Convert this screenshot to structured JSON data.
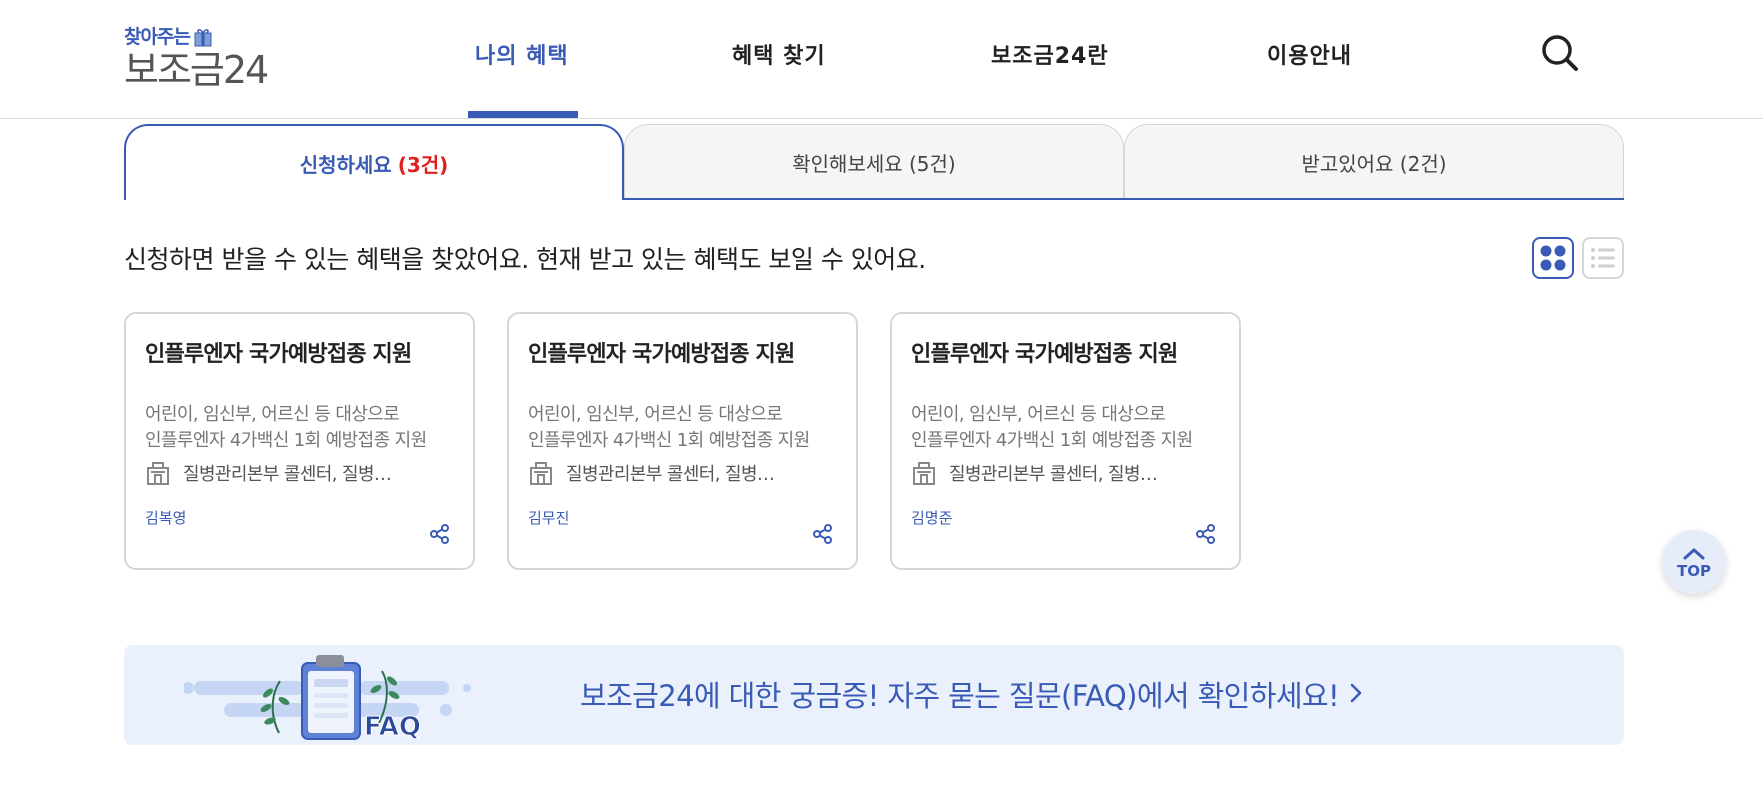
{
  "header": {
    "logo_top": "찾아주는",
    "logo_main": "보조금24",
    "nav": [
      {
        "label": "나의 혜택",
        "active": true
      },
      {
        "label": "혜택 찾기",
        "active": false
      },
      {
        "label": "보조금24란",
        "active": false
      },
      {
        "label": "이용안내",
        "active": false
      }
    ],
    "search_icon": "search-icon"
  },
  "tabs": [
    {
      "label": "신청하세요",
      "count": "(3건)",
      "active": true
    },
    {
      "label": "확인해보세요 (5건)",
      "active": false
    },
    {
      "label": "받고있어요 (2건)",
      "active": false
    }
  ],
  "page_heading": "신청하면 받을 수 있는 혜택을 찾았어요. 현재 받고 있는 혜택도 보일 수 있어요.",
  "view_toggle": {
    "grid_icon": "grid-view-icon",
    "list_icon": "list-view-icon",
    "selected": "grid"
  },
  "cards": [
    {
      "title": "인플루엔자 국가예방접종 지원",
      "desc_line1": "어린이, 임신부, 어르신 등 대상으로",
      "desc_line2": "인플루엔자 4가백신 1회 예방접종 지원",
      "agency": "질병관리본부 콜센터, 질병…",
      "person": "김복영"
    },
    {
      "title": "인플루엔자 국가예방접종 지원",
      "desc_line1": "어린이, 임신부, 어르신 등 대상으로",
      "desc_line2": "인플루엔자 4가백신 1회 예방접종 지원",
      "agency": "질병관리본부 콜센터, 질병…",
      "person": "김무진"
    },
    {
      "title": "인플루엔자 국가예방접종 지원",
      "desc_line1": "어린이, 임신부, 어르신 등 대상으로",
      "desc_line2": "인플루엔자 4가백신 1회 예방접종 지원",
      "agency": "질병관리본부 콜센터, 질병…",
      "person": "김명준"
    }
  ],
  "top_button": {
    "label": "TOP"
  },
  "faq": {
    "illustration_text": "FAQ",
    "text": "보조금24에 대한 궁금증! 자주 묻는 질문(FAQ)에서 확인하세요!"
  },
  "colors": {
    "accent": "#3a5bb5",
    "count_red": "#e02020",
    "faq_bg": "#eaf1fd"
  }
}
